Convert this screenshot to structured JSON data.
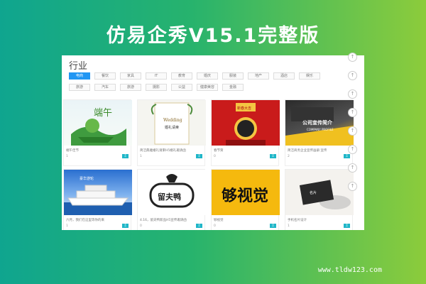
{
  "banner": {
    "title": "仿易企秀V15.1完整版",
    "url": "www.tldw123.com"
  },
  "panel": {
    "title": "行业"
  },
  "filters": {
    "row1": [
      {
        "label": "电商",
        "active": true
      },
      {
        "label": "餐饮",
        "active": false
      },
      {
        "label": "家具",
        "active": false
      },
      {
        "label": "IT",
        "active": false
      },
      {
        "label": "教育",
        "active": false
      },
      {
        "label": "婚庆",
        "active": false
      },
      {
        "label": "服装",
        "active": false
      },
      {
        "label": "地产",
        "active": false
      },
      {
        "label": "酒店",
        "active": false
      },
      {
        "label": "娱乐",
        "active": false
      }
    ],
    "row2": [
      {
        "label": "旅游",
        "active": false
      },
      {
        "label": "汽车",
        "active": false
      },
      {
        "label": "旅游",
        "active": false
      },
      {
        "label": "摄影",
        "active": false
      },
      {
        "label": "公益",
        "active": false
      },
      {
        "label": "健康美容",
        "active": false
      },
      {
        "label": "金融",
        "active": false
      }
    ]
  },
  "cards": [
    {
      "title": "端午佳节",
      "count": "1",
      "thumb": "dragon-boat-festival",
      "thumb_text": "端午"
    },
    {
      "title": "简洁典雅婚礼请柬H5婚礼邀请函",
      "count": "1",
      "thumb": "wedding-invitation",
      "thumb_text": "婚礼请柬"
    },
    {
      "title": "春节贺",
      "count": "0",
      "thumb": "chinese-new-year",
      "thumb_text": "新春大吉"
    },
    {
      "title": "简洁商务企业宣传画册 宣传",
      "count": "2",
      "thumb": "company-profile",
      "thumb_text": "公司宣传简介"
    },
    {
      "title": "六月，我们在这里等你的来",
      "count": "1",
      "thumb": "cruise-ship",
      "thumb_text": "豪华游轮"
    },
    {
      "title": "4.16，留夫鸭新品H5宣传邀请函",
      "count": "0",
      "thumb": "liufuya-logo",
      "thumb_text": "留夫鸭"
    },
    {
      "title": "够视觉",
      "count": "0",
      "thumb": "gou-shijue",
      "thumb_text": "够视觉"
    },
    {
      "title": "手机名片设计",
      "count": "1",
      "thumb": "business-card",
      "thumb_text": "名片"
    }
  ],
  "colors": {
    "accent": "#2196f3",
    "download": "#1fb6c8"
  }
}
